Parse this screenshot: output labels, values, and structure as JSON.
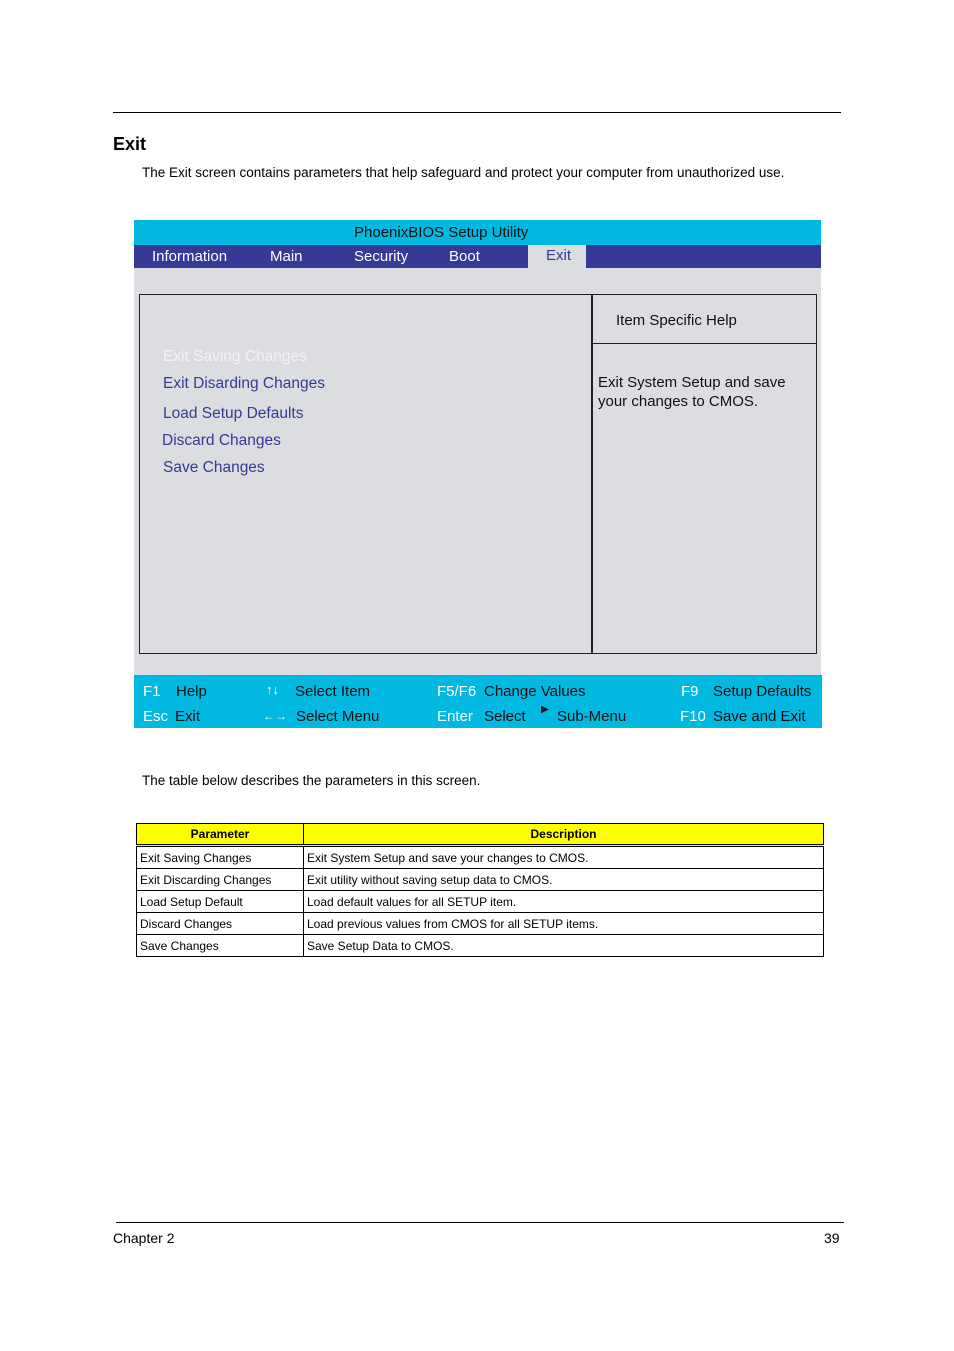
{
  "page": {
    "section_title": "Exit",
    "intro": "The Exit screen contains parameters that help safeguard and protect your computer from unauthorized use.",
    "table_intro": "The table below describes the parameters in this screen.",
    "footer_left": "Chapter 2",
    "footer_right": "39"
  },
  "bios": {
    "title": "PhoenixBIOS Setup Utility",
    "colors": {
      "title_bg": "#00b8e0",
      "menubar_bg": "#343a96",
      "body_bg": "#dcdde0",
      "option_text": "#343a96"
    },
    "menu": [
      {
        "label": "Information",
        "active": false
      },
      {
        "label": "Main",
        "active": false
      },
      {
        "label": "Security",
        "active": false
      },
      {
        "label": "Boot",
        "active": false
      },
      {
        "label": "Exit",
        "active": true
      }
    ],
    "options": [
      {
        "label": "Exit Saving Changes",
        "selected": true
      },
      {
        "label": "Exit Disarding Changes",
        "selected": false
      },
      {
        "label": "Load Setup Defaults",
        "selected": false
      },
      {
        "label": "Discard Changes",
        "selected": false
      },
      {
        "label": "Save Changes",
        "selected": false
      }
    ],
    "help": {
      "heading": "Item Specific Help",
      "text": "Exit System Setup and save your changes to CMOS."
    },
    "keys": {
      "f1": {
        "key": "F1",
        "action": "Help"
      },
      "esc": {
        "key": "Esc",
        "action": "Exit"
      },
      "updown": {
        "key": "↑↓",
        "action": "Select Item"
      },
      "leftright": {
        "key": "←→",
        "action": "Select Menu"
      },
      "f5f6": {
        "key": "F5/F6",
        "action": "Change Values"
      },
      "enter": {
        "key": "Enter",
        "action": "Select",
        "extra": "Sub-Menu"
      },
      "f9": {
        "key": "F9",
        "action": "Setup Defaults"
      },
      "f10": {
        "key": "F10",
        "action": "Save and Exit"
      }
    }
  },
  "table": {
    "headers": [
      "Parameter",
      "Description"
    ],
    "header_bg": "#ffff00",
    "rows": [
      [
        "Exit Saving Changes",
        "Exit System Setup and save your changes to CMOS."
      ],
      [
        "Exit Discarding Changes",
        "Exit utility without saving setup data to CMOS."
      ],
      [
        "Load Setup Default",
        "Load default values for all SETUP item."
      ],
      [
        "Discard Changes",
        "Load previous values from CMOS for all SETUP items."
      ],
      [
        "Save Changes",
        "Save Setup Data to CMOS."
      ]
    ]
  }
}
